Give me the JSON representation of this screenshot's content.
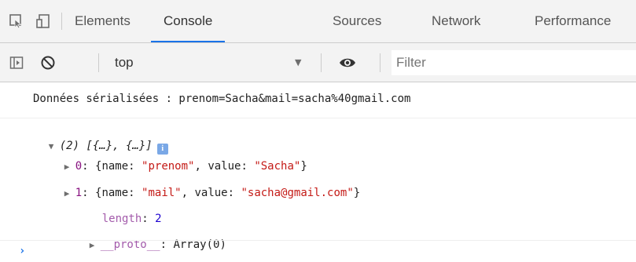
{
  "tabs": [
    {
      "label": "Elements",
      "active": false
    },
    {
      "label": "Console",
      "active": true
    },
    {
      "label": "Sources",
      "active": false
    },
    {
      "label": "Network",
      "active": false
    },
    {
      "label": "Performance",
      "active": false
    }
  ],
  "toolbar": {
    "context": "top",
    "filter_placeholder": "Filter",
    "filter_value": ""
  },
  "console": {
    "message": "Données sérialisées : prenom=Sacha&mail=sacha%40gmail.com",
    "array": {
      "summary": "(2) [{…}, {…}]",
      "info_badge": "i",
      "items": [
        {
          "index": "0",
          "name": "\"prenom\"",
          "value": "\"Sacha\""
        },
        {
          "index": "1",
          "name": "\"mail\"",
          "value": "\"sacha@gmail.com\""
        }
      ],
      "length_key": "length",
      "length_value": "2",
      "proto_key": "__proto__",
      "proto_value": "Array(0)"
    },
    "prompt": "›"
  },
  "colors": {
    "accent": "#1a73e8",
    "string": "#c41a16",
    "number": "#1c00cf",
    "key": "#881280"
  },
  "icons": [
    "inspect-element-icon",
    "device-toolbar-icon",
    "sidebar-toggle-icon",
    "clear-console-icon",
    "eye-icon",
    "dropdown-arrow-icon",
    "expand-triangle-icon",
    "collapse-triangle-icon"
  ]
}
